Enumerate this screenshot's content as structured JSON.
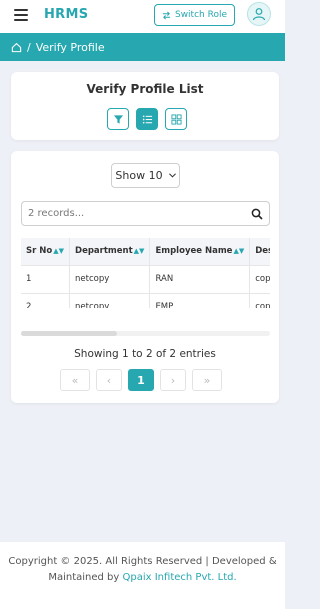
{
  "header": {
    "brand": "HRMS",
    "switch_role_label": "Switch Role",
    "accent_color": "#27a7b0"
  },
  "breadcrumb": {
    "home_icon": "home-icon",
    "separator": "/",
    "current": "Verify Profile"
  },
  "list_card": {
    "title": "Verify Profile List",
    "view_buttons": [
      "filter-icon",
      "list-icon",
      "grid-icon"
    ],
    "active_view": "list"
  },
  "table_card": {
    "page_size": "Show 10",
    "search_placeholder": "2 records...",
    "columns": [
      "Sr No",
      "Department",
      "Employee Name",
      "Des"
    ],
    "rows": [
      [
        "1",
        "netcopy",
        "RAN",
        "cop"
      ],
      [
        "2",
        "netcopy",
        "EMP",
        "cop"
      ]
    ],
    "entries_text": "Showing 1 to 2 of 2 entries",
    "pagination": {
      "first": "«",
      "prev": "‹",
      "current": "1",
      "next": "›",
      "last": "»"
    }
  },
  "footer": {
    "line1": "Copyright © 2025. All Rights Reserved | Developed &",
    "line2_prefix": "Maintained by ",
    "company": "Qpaix Infitech Pvt. Ltd."
  }
}
